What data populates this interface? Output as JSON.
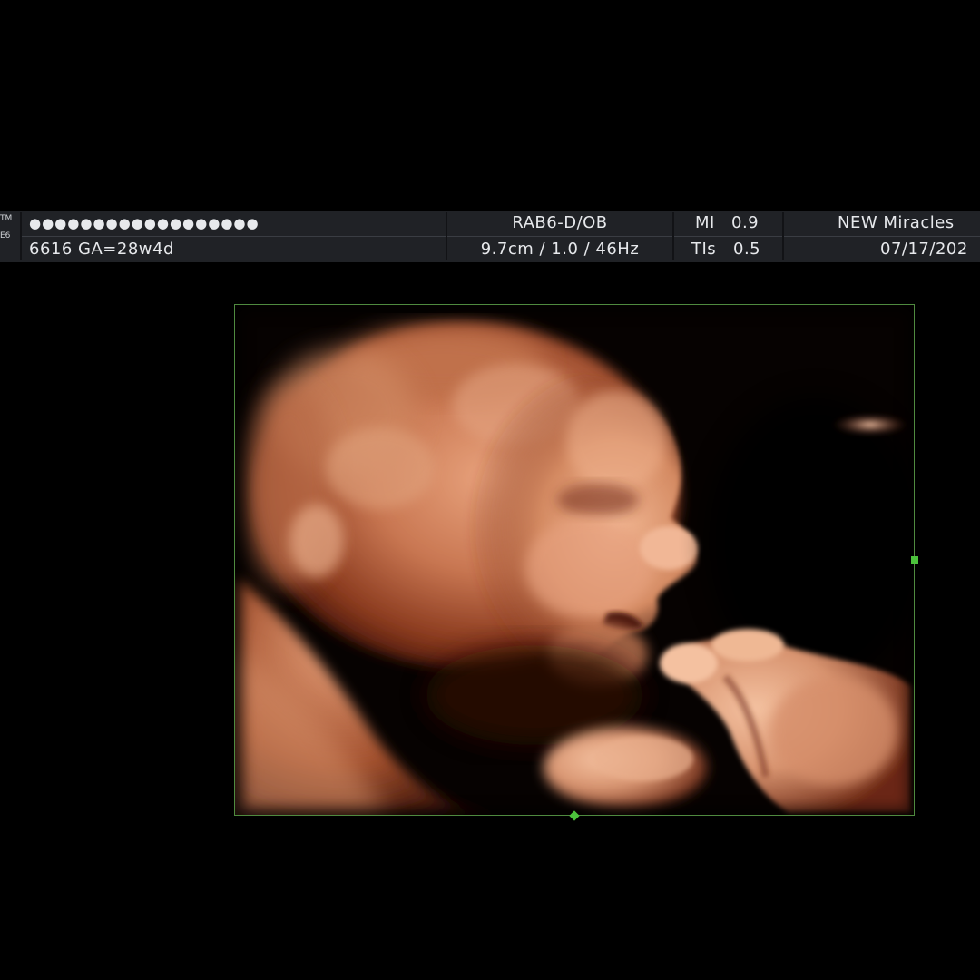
{
  "header": {
    "logo_fragment": [
      "TM",
      "E6"
    ],
    "patient_id_masked": "●●●●●●●●●●●●●●●●●●",
    "patient_ga": "6616  GA=28w4d",
    "probe_preset": "RAB6-D/OB",
    "depth_settings": "9.7cm / 1.0 / 46Hz",
    "mi_label": "MI",
    "mi_value": "0.9",
    "tis_label": "TIs",
    "tis_value": "0.5",
    "clinic_name": "NEW Miracles",
    "exam_date": "07/17/202"
  },
  "colors": {
    "header_bg": "#202226",
    "header_text": "#e7e9ec",
    "roi_border": "#4f8a3f",
    "roi_handle": "#4cc33c",
    "tissue_highlight": "#f0b28e",
    "tissue_mid": "#b35a36",
    "tissue_shadow": "#3a0f06"
  },
  "image": {
    "type": "3D/4D obstetric ultrasound volume render",
    "subject": "fetal face in profile with hand near mouth"
  }
}
